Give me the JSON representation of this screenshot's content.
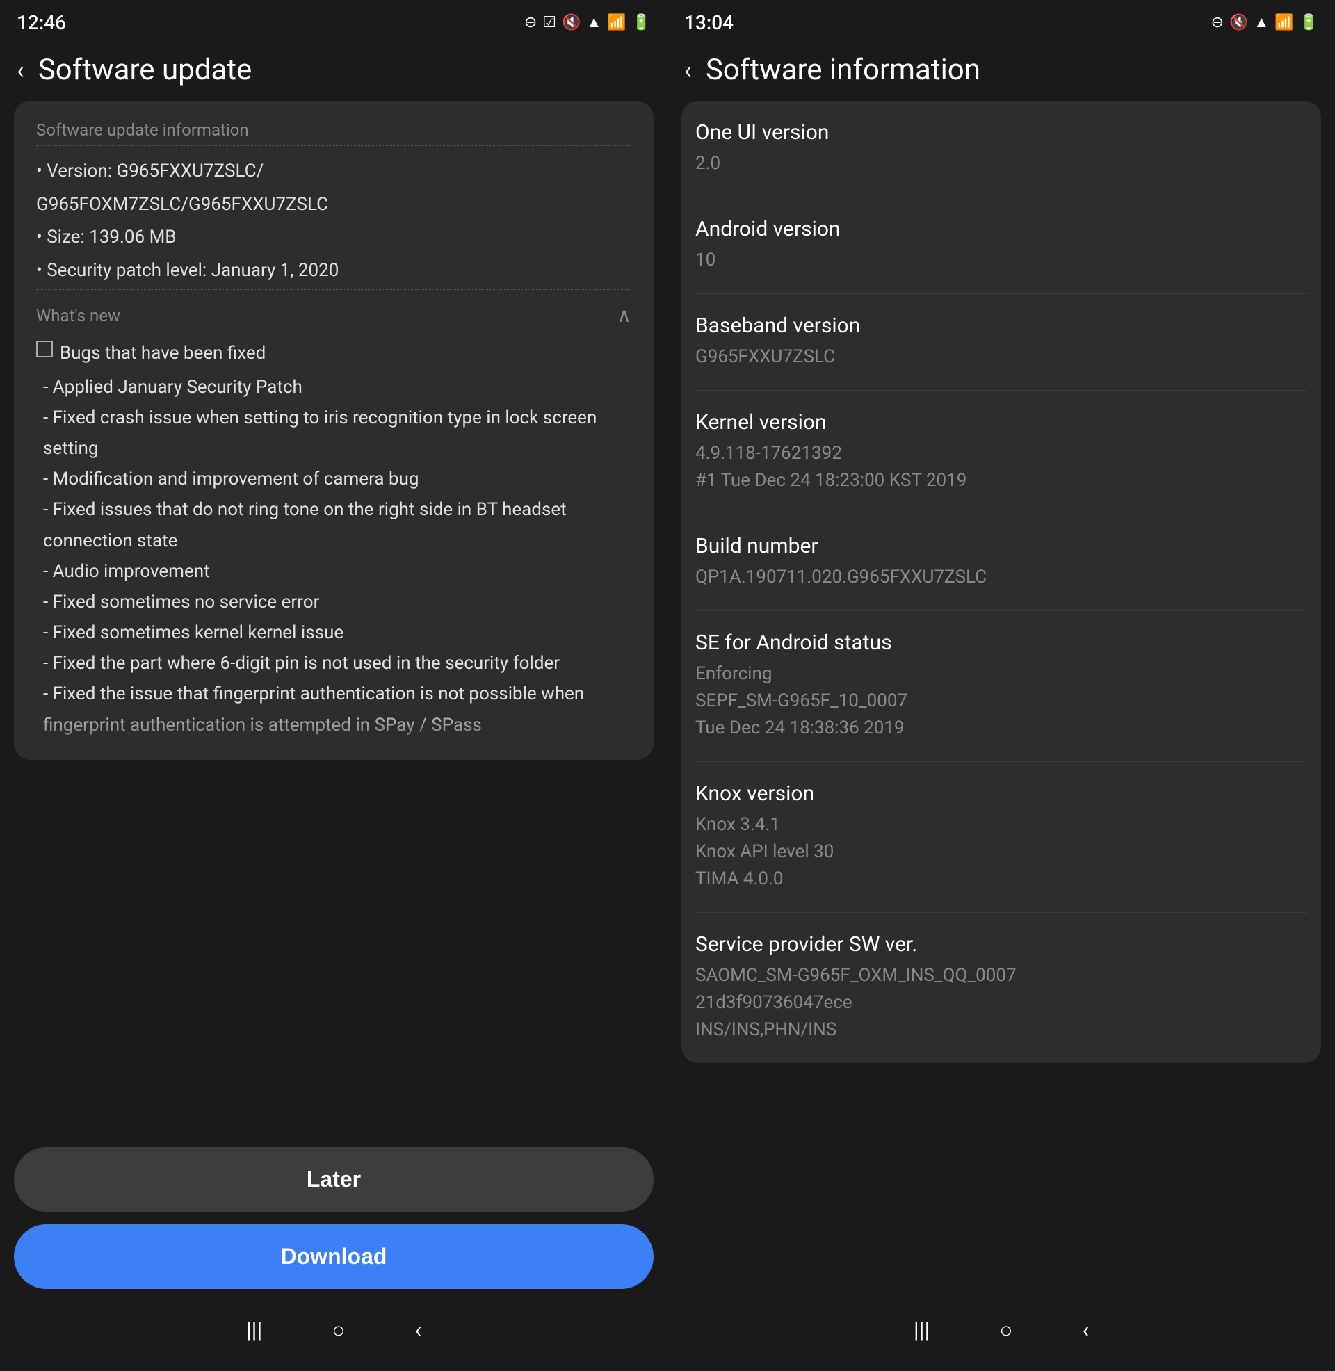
{
  "left_panel": {
    "status_bar": {
      "time": "12:46",
      "icons": [
        "minus-circle",
        "check-square",
        "mute",
        "wifi",
        "signal",
        "battery"
      ]
    },
    "toolbar": {
      "back_label": "‹",
      "title": "Software update"
    },
    "update_info": {
      "section_label": "Software update information",
      "version_label": "• Version: G965FXXU7ZSLC/",
      "version_label2": "  G965FOXM7ZSLC/G965FXXU7ZSLC",
      "size_label": "• Size: 139.06 MB",
      "security_label": "• Security patch level: January 1, 2020"
    },
    "whats_new": {
      "section_label": "What's new",
      "bugs_title": "Bugs that have been fixed",
      "fixes": [
        "- Applied January Security Patch",
        "- Fixed crash issue when setting to iris recognition type in lock screen setting",
        "- Modification and improvement of camera bug",
        "- Fixed issues that do not ring tone on the right side in BT headset connection state",
        "- Audio improvement",
        "- Fixed sometimes no service error",
        "- Fixed sometimes kernel kernel issue",
        "- Fixed the part where 6-digit pin is not used in the security folder",
        "- Fixed the issue that fingerprint authentication is not possible when fingerprint authentication is attempted in SPay / SPass"
      ]
    },
    "buttons": {
      "later_label": "Later",
      "download_label": "Download"
    },
    "nav": {
      "menu_icon": "|||",
      "home_icon": "○",
      "back_icon": "‹"
    }
  },
  "right_panel": {
    "status_bar": {
      "time": "13:04",
      "icons": [
        "minus-circle",
        "mute",
        "wifi",
        "signal",
        "battery"
      ]
    },
    "toolbar": {
      "back_label": "‹",
      "title": "Software information"
    },
    "info_items": [
      {
        "label": "One UI version",
        "value": "2.0"
      },
      {
        "label": "Android version",
        "value": "10"
      },
      {
        "label": "Baseband version",
        "value": "G965FXXU7ZSLC"
      },
      {
        "label": "Kernel version",
        "value": "4.9.118-17621392\n#1 Tue Dec 24 18:23:00 KST 2019"
      },
      {
        "label": "Build number",
        "value": "QP1A.190711.020.G965FXXU7ZSLC"
      },
      {
        "label": "SE for Android status",
        "value": "Enforcing\nSEPF_SM-G965F_10_0007\nTue Dec 24 18:38:36 2019"
      },
      {
        "label": "Knox version",
        "value": "Knox 3.4.1\nKnox API level 30\nTIMA 4.0.0"
      },
      {
        "label": "Service provider SW ver.",
        "value": "SAOMC_SM-G965F_OXM_INS_QQ_0007\n21d3f90736047ece\nINS/INS,PHN/INS"
      }
    ],
    "nav": {
      "menu_icon": "|||",
      "home_icon": "○",
      "back_icon": "‹"
    }
  }
}
